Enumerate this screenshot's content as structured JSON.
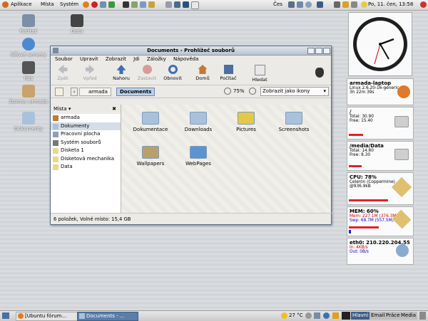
{
  "top_panel": {
    "menus": [
      "Aplikace",
      "Místa",
      "Systém"
    ],
    "locale": "Čes",
    "datetime": "Po, 11. čen, 13:58"
  },
  "desktop_icons": [
    {
      "label": "Počítač",
      "icon": "computer-icon"
    },
    {
      "label": "Data",
      "icon": "drive-icon"
    },
    {
      "label": "Síťové servery",
      "icon": "network-globe-icon"
    },
    {
      "label": "hbs",
      "icon": "harddisk-icon"
    },
    {
      "label": "Domov armada",
      "icon": "home-icon"
    },
    {
      "label": "Dokumenty",
      "icon": "folder-icon"
    }
  ],
  "window": {
    "title": "Documents - Prohlížeč souborů",
    "menus": [
      "Soubor",
      "Upravit",
      "Zobrazit",
      "Jdi",
      "Záložky",
      "Nápověda"
    ],
    "toolbar": [
      {
        "label": "Zpět",
        "enabled": false
      },
      {
        "label": "Vpřed",
        "enabled": false
      },
      {
        "label": "Nahoru",
        "enabled": true
      },
      {
        "label": "Zastavit",
        "enabled": false
      },
      {
        "label": "Obnovit",
        "enabled": true
      },
      {
        "label": "Domů",
        "enabled": true
      },
      {
        "label": "Počítač",
        "enabled": true
      },
      {
        "label": "Hledat",
        "enabled": true
      }
    ],
    "path": [
      "armada",
      "Documents"
    ],
    "zoom": "75%",
    "view_mode": "Zobrazit jako ikony",
    "sidebar_title": "Místa",
    "places": [
      "armada",
      "Dokumenty",
      "Pracovní plocha",
      "Systém souborů",
      "Disketa 1",
      "Disketová mechanika",
      "Data"
    ],
    "selected_place": "Dokumenty",
    "files": [
      "Dokumentace",
      "Downloads",
      "Pictures",
      "Screenshots",
      "Wallpapers",
      "WebPages"
    ],
    "status": "6 položek, Volné místo: 15,4 GB"
  },
  "widgets": {
    "host": {
      "name": "armada-laptop",
      "line1": "Linux 2.6.20-16-generic",
      "line2": "3h 22m 39s"
    },
    "fs_root": {
      "name": "/",
      "total": "Total: 30.90",
      "free": "Free: 15.40"
    },
    "fs_data": {
      "name": "/media/Data",
      "total": "Total: 14.80",
      "free": "Free: 8.30"
    },
    "cpu": {
      "title": "CPU: 78%",
      "line1": "Celeron (Coppermine)",
      "line2": "@936.9kB",
      "usage": 0.78
    },
    "mem": {
      "title": "MEM: 60%",
      "line1": "Mem: 227.1M (376.3M)",
      "line2": "Swp: 68.7M (557.5M)",
      "usage": 0.6
    },
    "net": {
      "title": "eth0: 210.220.204.55",
      "line1": "In: 4KB/s",
      "line2": "Out: 0B/s"
    }
  },
  "bottom_panel": {
    "tasks": [
      "[Ubuntu fórum...",
      "Documents - ..."
    ],
    "temperature": "27 °C",
    "workspaces": [
      "Hlavní",
      "Email",
      "Práce",
      "Media"
    ]
  }
}
